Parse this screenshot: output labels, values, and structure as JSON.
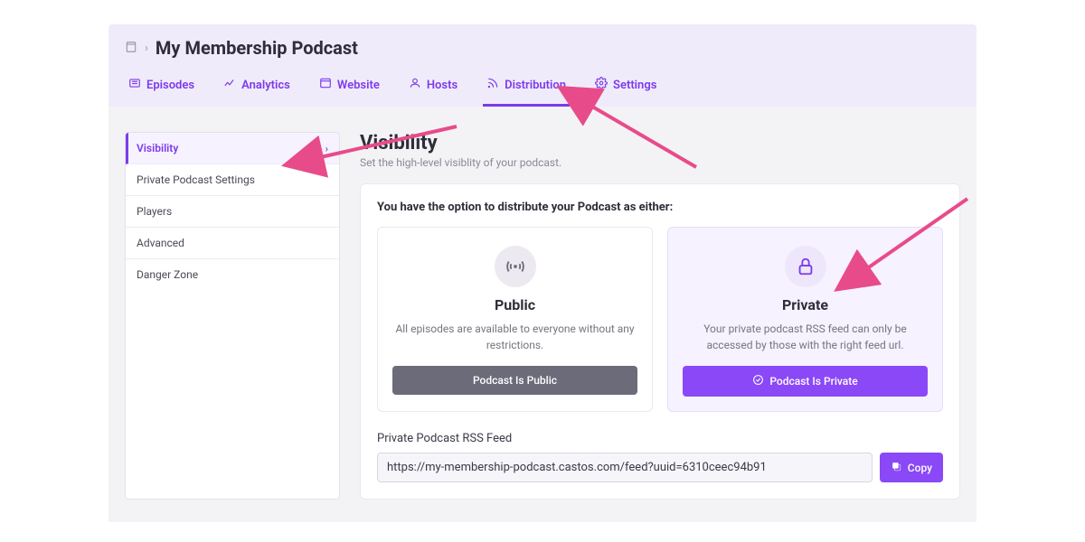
{
  "breadcrumb": {
    "title": "My Membership Podcast"
  },
  "tabs": [
    {
      "label": "Episodes"
    },
    {
      "label": "Analytics"
    },
    {
      "label": "Website"
    },
    {
      "label": "Hosts"
    },
    {
      "label": "Distribution"
    },
    {
      "label": "Settings"
    }
  ],
  "sidebar": {
    "items": [
      {
        "label": "Visibility"
      },
      {
        "label": "Private Podcast Settings"
      },
      {
        "label": "Players"
      },
      {
        "label": "Advanced"
      },
      {
        "label": "Danger Zone"
      }
    ]
  },
  "page": {
    "title": "Visibility",
    "subtitle": "Set the high-level visiblity of your podcast."
  },
  "card": {
    "title": "You have the option to distribute your Podcast as either:",
    "public": {
      "title": "Public",
      "desc": "All episodes are available to everyone without any restrictions.",
      "btn": "Podcast Is Public"
    },
    "private": {
      "title": "Private",
      "desc": "Your private podcast RSS feed can only be accessed by those with the right feed url.",
      "btn": "Podcast Is Private"
    },
    "feed": {
      "label": "Private Podcast RSS Feed",
      "url": "https://my-membership-podcast.castos.com/feed?uuid=6310ceec94b91",
      "copy": "Copy"
    }
  }
}
